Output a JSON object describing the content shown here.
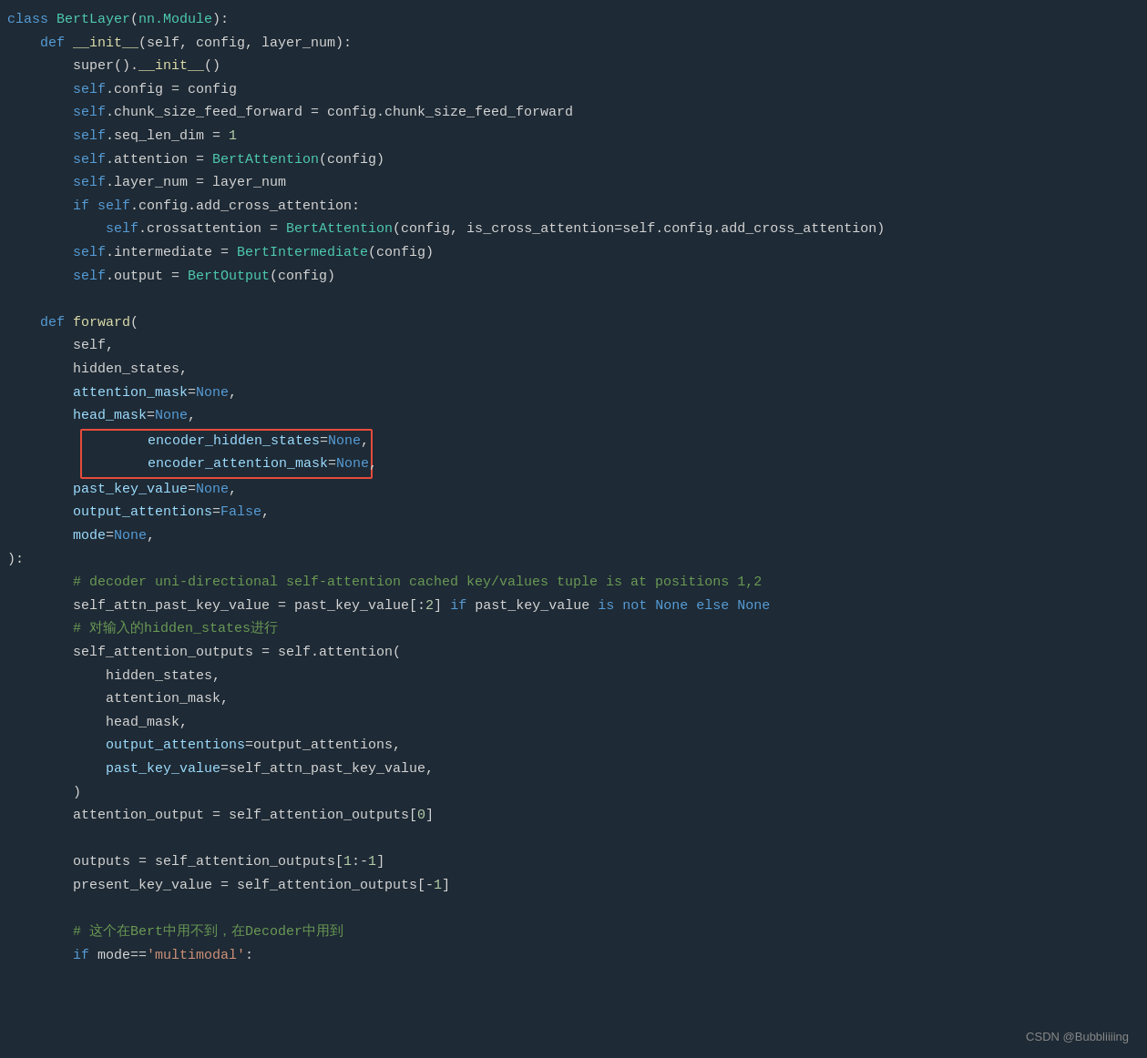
{
  "watermark": {
    "text": "CSDN @Bubbliiiing"
  },
  "code": {
    "lines": [
      {
        "id": 1,
        "tokens": [
          {
            "t": "class ",
            "c": "kw"
          },
          {
            "t": "BertLayer",
            "c": "cn"
          },
          {
            "t": "(",
            "c": "pn"
          },
          {
            "t": "nn.Module",
            "c": "cn"
          },
          {
            "t": "):",
            "c": "pn"
          }
        ]
      },
      {
        "id": 2,
        "tokens": [
          {
            "t": "    ",
            "c": "plain"
          },
          {
            "t": "def ",
            "c": "kw"
          },
          {
            "t": "__init__",
            "c": "fn"
          },
          {
            "t": "(self, config, layer_num):",
            "c": "plain"
          }
        ]
      },
      {
        "id": 3,
        "tokens": [
          {
            "t": "        ",
            "c": "plain"
          },
          {
            "t": "super",
            "c": "plain"
          },
          {
            "t": "()",
            "c": "pn"
          },
          {
            "t": ".",
            "c": "plain"
          },
          {
            "t": "__init__",
            "c": "fn"
          },
          {
            "t": "()",
            "c": "pn"
          }
        ]
      },
      {
        "id": 4,
        "tokens": [
          {
            "t": "        ",
            "c": "plain"
          },
          {
            "t": "self",
            "c": "self-kw"
          },
          {
            "t": ".config = config",
            "c": "plain"
          }
        ]
      },
      {
        "id": 5,
        "tokens": [
          {
            "t": "        ",
            "c": "plain"
          },
          {
            "t": "self",
            "c": "self-kw"
          },
          {
            "t": ".chunk_size_feed_forward = config.chunk_size_feed_forward",
            "c": "plain"
          }
        ]
      },
      {
        "id": 6,
        "tokens": [
          {
            "t": "        ",
            "c": "plain"
          },
          {
            "t": "self",
            "c": "self-kw"
          },
          {
            "t": ".seq_len_dim = ",
            "c": "plain"
          },
          {
            "t": "1",
            "c": "num"
          }
        ]
      },
      {
        "id": 7,
        "tokens": [
          {
            "t": "        ",
            "c": "plain"
          },
          {
            "t": "self",
            "c": "self-kw"
          },
          {
            "t": ".attention = ",
            "c": "plain"
          },
          {
            "t": "BertAttention",
            "c": "cn"
          },
          {
            "t": "(config)",
            "c": "plain"
          }
        ]
      },
      {
        "id": 8,
        "tokens": [
          {
            "t": "        ",
            "c": "plain"
          },
          {
            "t": "self",
            "c": "self-kw"
          },
          {
            "t": ".layer_num = layer_num",
            "c": "plain"
          }
        ]
      },
      {
        "id": 9,
        "tokens": [
          {
            "t": "        ",
            "c": "plain"
          },
          {
            "t": "if ",
            "c": "kw"
          },
          {
            "t": "self",
            "c": "self-kw"
          },
          {
            "t": ".config.add_cross_attention:",
            "c": "plain"
          }
        ]
      },
      {
        "id": 10,
        "tokens": [
          {
            "t": "            ",
            "c": "plain"
          },
          {
            "t": "self",
            "c": "self-kw"
          },
          {
            "t": ".crossattention = ",
            "c": "plain"
          },
          {
            "t": "BertAttention",
            "c": "cn"
          },
          {
            "t": "(config, is_cross_attention=self.config.add_cross_attention)",
            "c": "plain"
          }
        ]
      },
      {
        "id": 11,
        "tokens": [
          {
            "t": "        ",
            "c": "plain"
          },
          {
            "t": "self",
            "c": "self-kw"
          },
          {
            "t": ".intermediate = ",
            "c": "plain"
          },
          {
            "t": "BertIntermediate",
            "c": "cn"
          },
          {
            "t": "(config)",
            "c": "plain"
          }
        ]
      },
      {
        "id": 12,
        "tokens": [
          {
            "t": "        ",
            "c": "plain"
          },
          {
            "t": "self",
            "c": "self-kw"
          },
          {
            "t": ".output = ",
            "c": "plain"
          },
          {
            "t": "BertOutput",
            "c": "cn"
          },
          {
            "t": "(config)",
            "c": "plain"
          }
        ]
      },
      {
        "id": 13,
        "tokens": []
      },
      {
        "id": 14,
        "tokens": [
          {
            "t": "    ",
            "c": "plain"
          },
          {
            "t": "def ",
            "c": "kw"
          },
          {
            "t": "forward",
            "c": "fn"
          },
          {
            "t": "(",
            "c": "pn"
          }
        ]
      },
      {
        "id": 15,
        "tokens": [
          {
            "t": "        ",
            "c": "plain"
          },
          {
            "t": "self,",
            "c": "plain"
          }
        ]
      },
      {
        "id": 16,
        "tokens": [
          {
            "t": "        ",
            "c": "plain"
          },
          {
            "t": "hidden_states,",
            "c": "plain"
          }
        ]
      },
      {
        "id": 17,
        "tokens": [
          {
            "t": "        ",
            "c": "plain"
          },
          {
            "t": "attention_mask",
            "c": "light-blue"
          },
          {
            "t": "=",
            "c": "plain"
          },
          {
            "t": "None",
            "c": "val-none"
          },
          {
            "t": ",",
            "c": "plain"
          }
        ]
      },
      {
        "id": 18,
        "tokens": [
          {
            "t": "        ",
            "c": "plain"
          },
          {
            "t": "head_mask",
            "c": "light-blue"
          },
          {
            "t": "=",
            "c": "plain"
          },
          {
            "t": "None",
            "c": "val-none"
          },
          {
            "t": ",",
            "c": "plain"
          }
        ]
      },
      {
        "id": 19,
        "tokens": [
          {
            "t": "        ",
            "c": "plain"
          },
          {
            "t": "encoder_hidden_states",
            "c": "light-blue"
          },
          {
            "t": "=",
            "c": "plain"
          },
          {
            "t": "None",
            "c": "val-none"
          },
          {
            "t": ",",
            "c": "plain"
          }
        ],
        "highlight": true
      },
      {
        "id": 20,
        "tokens": [
          {
            "t": "        ",
            "c": "plain"
          },
          {
            "t": "encoder_attention_mask",
            "c": "light-blue"
          },
          {
            "t": "=",
            "c": "plain"
          },
          {
            "t": "None",
            "c": "val-none"
          },
          {
            "t": ",",
            "c": "plain"
          }
        ],
        "highlight": true
      },
      {
        "id": 21,
        "tokens": [
          {
            "t": "        ",
            "c": "plain"
          },
          {
            "t": "past_key_value",
            "c": "light-blue"
          },
          {
            "t": "=",
            "c": "plain"
          },
          {
            "t": "None",
            "c": "val-none"
          },
          {
            "t": ",",
            "c": "plain"
          }
        ]
      },
      {
        "id": 22,
        "tokens": [
          {
            "t": "        ",
            "c": "plain"
          },
          {
            "t": "output_attentions",
            "c": "light-blue"
          },
          {
            "t": "=",
            "c": "plain"
          },
          {
            "t": "False",
            "c": "val-none"
          },
          {
            "t": ",",
            "c": "plain"
          }
        ]
      },
      {
        "id": 23,
        "tokens": [
          {
            "t": "        ",
            "c": "plain"
          },
          {
            "t": "mode",
            "c": "light-blue"
          },
          {
            "t": "=",
            "c": "plain"
          },
          {
            "t": "None",
            "c": "val-none"
          },
          {
            "t": ",",
            "c": "plain"
          }
        ]
      },
      {
        "id": 24,
        "tokens": [
          {
            "t": "):",
            "c": "plain"
          }
        ]
      },
      {
        "id": 25,
        "tokens": [
          {
            "t": "        ",
            "c": "plain"
          },
          {
            "t": "# decoder uni-directional self-attention cached key/values tuple is at positions 1,2",
            "c": "cm"
          }
        ]
      },
      {
        "id": 26,
        "tokens": [
          {
            "t": "        ",
            "c": "plain"
          },
          {
            "t": "self_attn_past_key_value = past_key_value[:",
            "c": "plain"
          },
          {
            "t": "2",
            "c": "num"
          },
          {
            "t": "] ",
            "c": "plain"
          },
          {
            "t": "if ",
            "c": "kw"
          },
          {
            "t": "past_key_value ",
            "c": "plain"
          },
          {
            "t": "is not ",
            "c": "kw"
          },
          {
            "t": "None ",
            "c": "val-none"
          },
          {
            "t": "else ",
            "c": "kw"
          },
          {
            "t": "None",
            "c": "val-none"
          }
        ]
      },
      {
        "id": 27,
        "tokens": [
          {
            "t": "        ",
            "c": "plain"
          },
          {
            "t": "# 对输入的hidden_states进行",
            "c": "cm"
          }
        ]
      },
      {
        "id": 28,
        "tokens": [
          {
            "t": "        ",
            "c": "plain"
          },
          {
            "t": "self_attention_outputs = self.attention(",
            "c": "plain"
          }
        ]
      },
      {
        "id": 29,
        "tokens": [
          {
            "t": "            ",
            "c": "plain"
          },
          {
            "t": "hidden_states,",
            "c": "plain"
          }
        ]
      },
      {
        "id": 30,
        "tokens": [
          {
            "t": "            ",
            "c": "plain"
          },
          {
            "t": "attention_mask,",
            "c": "plain"
          }
        ]
      },
      {
        "id": 31,
        "tokens": [
          {
            "t": "            ",
            "c": "plain"
          },
          {
            "t": "head_mask,",
            "c": "plain"
          }
        ]
      },
      {
        "id": 32,
        "tokens": [
          {
            "t": "            ",
            "c": "plain"
          },
          {
            "t": "output_attentions",
            "c": "light-blue"
          },
          {
            "t": "=output_attentions,",
            "c": "plain"
          }
        ]
      },
      {
        "id": 33,
        "tokens": [
          {
            "t": "            ",
            "c": "plain"
          },
          {
            "t": "past_key_value",
            "c": "light-blue"
          },
          {
            "t": "=self_attn_past_key_value,",
            "c": "plain"
          }
        ]
      },
      {
        "id": 34,
        "tokens": [
          {
            "t": "        ",
            "c": "plain"
          },
          {
            "t": ")",
            "c": "plain"
          }
        ]
      },
      {
        "id": 35,
        "tokens": [
          {
            "t": "        ",
            "c": "plain"
          },
          {
            "t": "attention_output = self_attention_outputs[",
            "c": "plain"
          },
          {
            "t": "0",
            "c": "num"
          },
          {
            "t": "]",
            "c": "plain"
          }
        ]
      },
      {
        "id": 36,
        "tokens": []
      },
      {
        "id": 37,
        "tokens": [
          {
            "t": "        ",
            "c": "plain"
          },
          {
            "t": "outputs = self_attention_outputs[",
            "c": "plain"
          },
          {
            "t": "1",
            "c": "num"
          },
          {
            "t": ":-",
            "c": "plain"
          },
          {
            "t": "1",
            "c": "num"
          },
          {
            "t": "]",
            "c": "plain"
          }
        ]
      },
      {
        "id": 38,
        "tokens": [
          {
            "t": "        ",
            "c": "plain"
          },
          {
            "t": "present_key_value = self_attention_outputs[-",
            "c": "plain"
          },
          {
            "t": "1",
            "c": "num"
          },
          {
            "t": "]",
            "c": "plain"
          }
        ]
      },
      {
        "id": 39,
        "tokens": []
      },
      {
        "id": 40,
        "tokens": [
          {
            "t": "        ",
            "c": "plain"
          },
          {
            "t": "# 这个在Bert中用不到，在Decoder中用到",
            "c": "cm"
          }
        ]
      },
      {
        "id": 41,
        "tokens": [
          {
            "t": "        ",
            "c": "plain"
          },
          {
            "t": "if ",
            "c": "kw"
          },
          {
            "t": "mode==",
            "c": "plain"
          },
          {
            "t": "'multimodal'",
            "c": "str"
          },
          {
            "t": ":",
            "c": "plain"
          }
        ]
      }
    ]
  }
}
